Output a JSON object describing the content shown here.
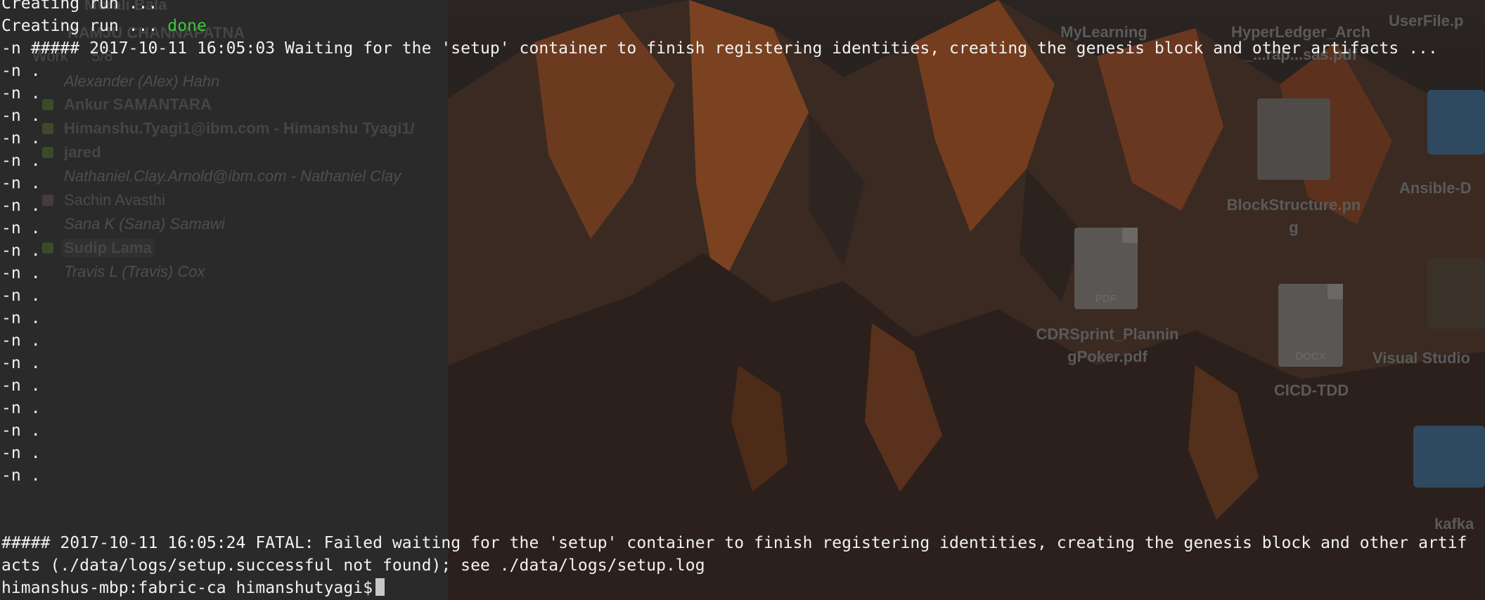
{
  "ghost_panel": {
    "header_partial": "Murali Bala",
    "header_partial2": "RAMJU CHANNAPATNA",
    "work_label": "Work",
    "work_count": "5/8",
    "rows": [
      {
        "text": "Alexander (Alex) Hahn",
        "style": "italic",
        "dot": false
      },
      {
        "text": "Ankur SAMANTARA",
        "style": "bold",
        "dot": true
      },
      {
        "text": "Himanshu.Tyagi1@ibm.com - Himanshu Tyagi1/",
        "style": "bold",
        "dot": true
      },
      {
        "text": "jared",
        "style": "bold",
        "dot": true
      },
      {
        "text": "Nathaniel.Clay.Arnold@ibm.com - Nathaniel Clay",
        "style": "italic",
        "dot": false
      },
      {
        "text": "Sachin Avasthi",
        "style": "normal",
        "dot": "calendar"
      },
      {
        "text": "Sana K (Sana) Samawi",
        "style": "italic",
        "dot": false
      },
      {
        "text": "Sudip Lama",
        "style": "bold",
        "dot": true
      },
      {
        "text": "Travis L (Travis) Cox",
        "style": "italic",
        "dot": false
      }
    ]
  },
  "desktop": {
    "icons": [
      {
        "label": "MyLearning",
        "kind": "folder"
      },
      {
        "label": "HyperLedger_Arch",
        "label2": "_...rap...sas.pdf",
        "kind": "pdf"
      },
      {
        "label": "UserFile.p",
        "kind": "file"
      },
      {
        "label": "BlockStructure.pn",
        "label2": "g",
        "kind": "image"
      },
      {
        "label": "Ansible-D",
        "kind": "folder"
      },
      {
        "label": "CDRSprint_Plannin",
        "label2": "gPoker.pdf",
        "kind": "pdf",
        "tag": "PDF"
      },
      {
        "label": "CICD-TDD",
        "kind": "docx",
        "tag": "DOCX"
      },
      {
        "label": "Visual Studio",
        "kind": "app"
      },
      {
        "label": "kafka",
        "kind": "folder"
      }
    ]
  },
  "terminal": {
    "line_partial": "Creating run ...",
    "creating_run": "Creating run ... ",
    "done": "done",
    "waiting": "-n ##### 2017-10-11 16:05:03 Waiting for the 'setup' container to finish registering identities, creating the genesis block and other artifacts ...",
    "dots": [
      "-n .",
      "-n .",
      "-n .",
      "-n .",
      "-n .",
      "-n .",
      "-n .",
      "-n .",
      "-n .",
      "-n .",
      "-n .",
      "-n .",
      "-n .",
      "-n .",
      "-n .",
      "-n .",
      "-n .",
      "-n .",
      "-n ."
    ],
    "fatal_line1": "##### 2017-10-11 16:05:24 FATAL: Failed waiting for the 'setup' container to finish registering identities, creating the genesis block and other artif",
    "fatal_line2": "acts (./data/logs/setup.successful not found); see ./data/logs/setup.log",
    "prompt": "himanshus-mbp:fabric-ca himanshutyagi$"
  },
  "colors": {
    "terminal_text": "#f2f2f2",
    "done_green": "#3ec53e",
    "panel_bg": "#2a2a2a"
  }
}
